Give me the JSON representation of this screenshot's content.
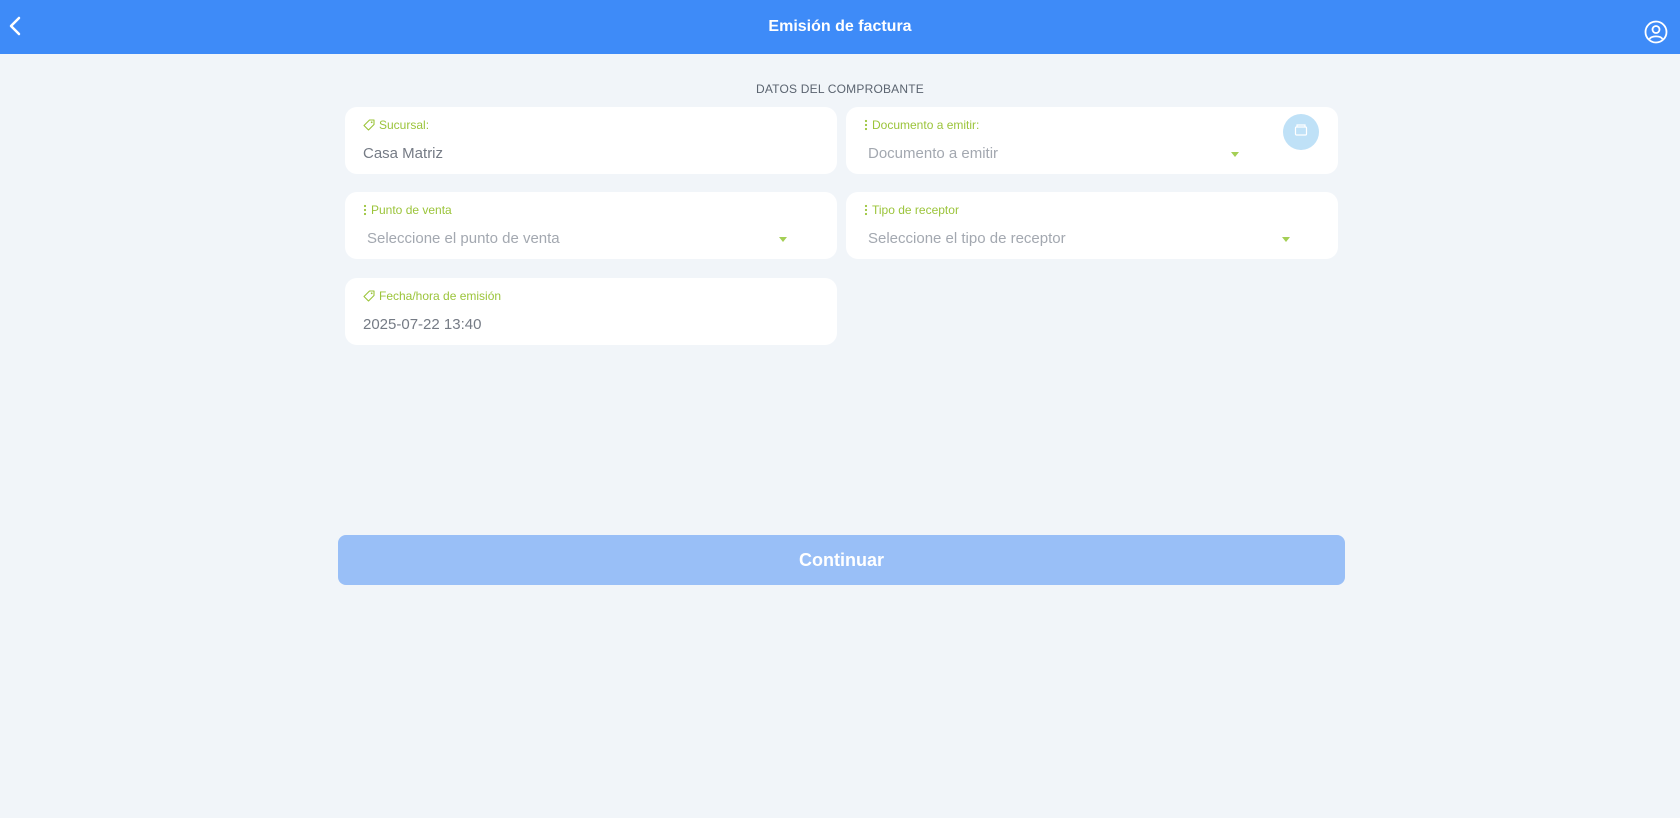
{
  "header": {
    "title": "Emisión de factura",
    "back_icon": "chevron-left-icon",
    "user_icon": "user-circle-icon"
  },
  "section": {
    "title": "DATOS DEL COMPROBANTE"
  },
  "fields": {
    "sucursal": {
      "label": "Sucursal:",
      "value": "Casa Matriz",
      "icon": "tag-icon"
    },
    "documento": {
      "label": "Documento a emitir:",
      "placeholder": "Documento a emitir",
      "icon": "vertical-dots-icon",
      "side_icon": "archive-icon"
    },
    "punto_venta": {
      "label": "Punto de venta",
      "placeholder": "Seleccione el punto de venta",
      "icon": "vertical-dots-icon"
    },
    "tipo_receptor": {
      "label": "Tipo de receptor",
      "placeholder": "Seleccione el tipo de receptor",
      "icon": "vertical-dots-icon"
    },
    "fecha": {
      "label": "Fecha/hora de emisión",
      "value": "2025-07-22 13:40",
      "icon": "tag-icon"
    }
  },
  "actions": {
    "continue_label": "Continuar"
  },
  "colors": {
    "header": "#3e8bf8",
    "label": "#9bc43a",
    "button": "#99bff7",
    "background": "#f1f5f9"
  }
}
